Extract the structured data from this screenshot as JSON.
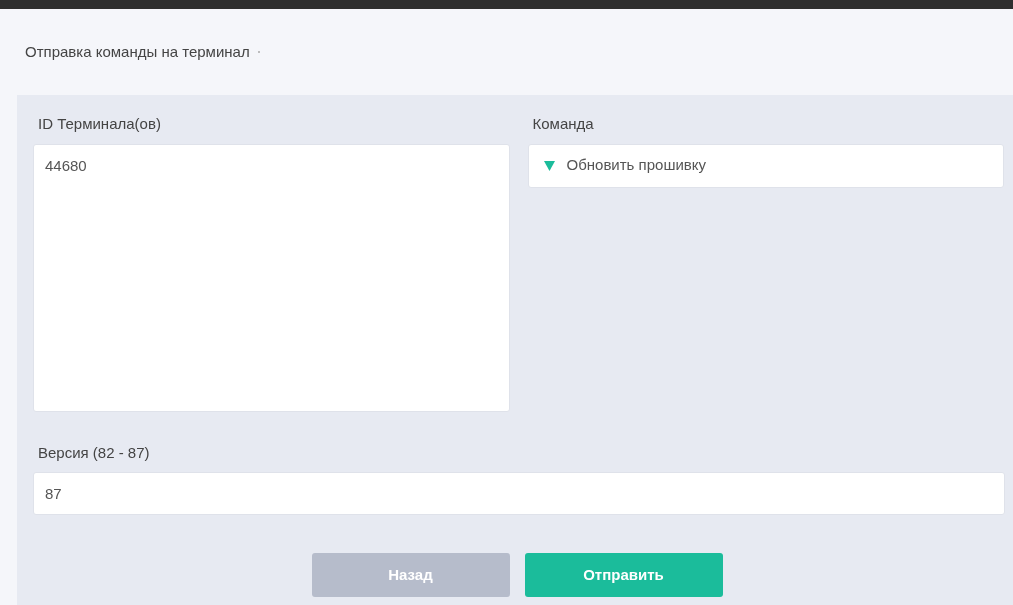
{
  "page_title": "Отправка команды на терминал",
  "form": {
    "terminal_ids": {
      "label": "ID Терминала(ов)",
      "value": "44680"
    },
    "command": {
      "label": "Команда",
      "value": "Обновить прошивку"
    },
    "version": {
      "label": "Версия (82 - 87)",
      "value": "87"
    }
  },
  "buttons": [
    {
      "label": "Назад",
      "kind": "secondary"
    },
    {
      "label": "Отправить",
      "kind": "primary"
    }
  ]
}
